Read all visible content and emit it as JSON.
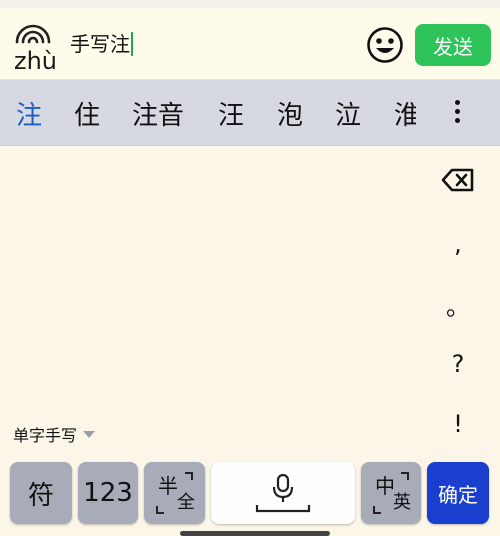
{
  "input_bar": {
    "pinyin_badge": "zhù",
    "text": "手写注",
    "send_label": "发送"
  },
  "candidates": [
    "注",
    "住",
    "注音",
    "汪",
    "泡",
    "泣",
    "淮"
  ],
  "side_keys": [
    ",",
    "。",
    "?",
    "!"
  ],
  "mode_selector": "单字手写",
  "keyboard": {
    "symbol_key": "符",
    "number_key": "123",
    "half_full": {
      "primary": "半",
      "secondary": "全"
    },
    "cn_en": {
      "primary": "中",
      "secondary": "英"
    },
    "confirm_key": "确定"
  },
  "colors": {
    "send_green": "#2ec45a",
    "confirm_blue": "#1a3fcf",
    "first_candidate": "#1e5ccc"
  },
  "icons": [
    "voice-wave-icon",
    "emoji-icon",
    "more-dots-icon",
    "backspace-icon",
    "microphone-icon",
    "space-bar-icon",
    "dropdown-triangle-icon"
  ]
}
